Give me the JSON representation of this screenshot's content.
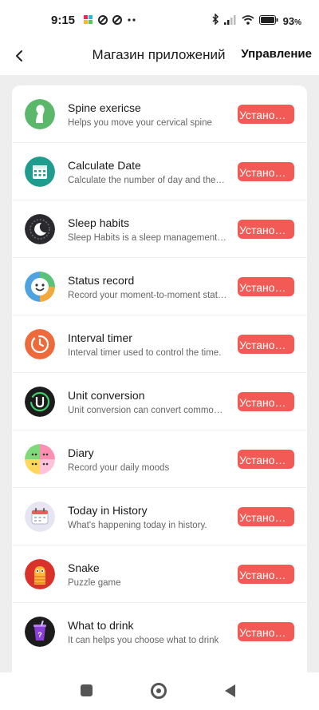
{
  "status_bar": {
    "time": "9:15",
    "battery_text": "93",
    "battery_unit": "%"
  },
  "header": {
    "title": "Магазин приложений",
    "manage_label": "Управление"
  },
  "apps": [
    {
      "name": "Spine exericse",
      "desc": "Helps you move your cervical spine",
      "button": "Установить",
      "icon": "spine-icon"
    },
    {
      "name": "Calculate Date",
      "desc": "Calculate the number of day and the difference",
      "button": "Установить",
      "icon": "calendar-icon"
    },
    {
      "name": "Sleep habits",
      "desc": "Sleep Habits is a sleep management tool",
      "button": "Установить",
      "icon": "moon-icon"
    },
    {
      "name": "Status record",
      "desc": "Record your moment-to-moment status",
      "button": "Установить",
      "icon": "smiley-icon"
    },
    {
      "name": "Interval timer",
      "desc": "Interval timer used to control the time.",
      "button": "Установить",
      "icon": "timer-icon"
    },
    {
      "name": "Unit conversion",
      "desc": "Unit conversion can convert common units",
      "button": "Установить",
      "icon": "unit-icon"
    },
    {
      "name": "Diary",
      "desc": "Record your daily moods",
      "button": "Установить",
      "icon": "diary-icon"
    },
    {
      "name": "Today in History",
      "desc": "What's happening today in history.",
      "button": "Установить",
      "icon": "history-calendar-icon"
    },
    {
      "name": "Snake",
      "desc": "Puzzle game",
      "button": "Установить",
      "icon": "snake-icon"
    },
    {
      "name": "What to drink",
      "desc": "It can helps you choose what to drink",
      "button": "Установить",
      "icon": "drink-icon"
    }
  ],
  "colors": {
    "install_button": "#f15a55",
    "background": "#eeeeee"
  }
}
